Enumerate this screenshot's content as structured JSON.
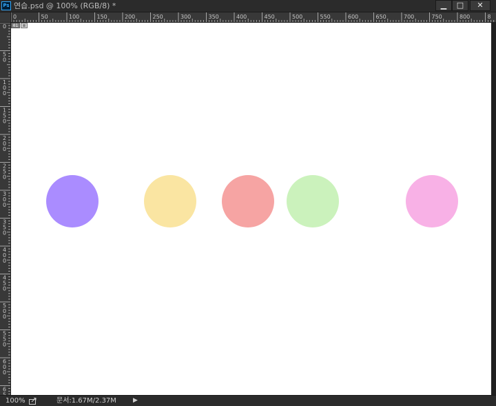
{
  "window": {
    "app_icon": "Ps",
    "title": "연습.psd @ 100% (RGB/8) *",
    "controls": {
      "minimize": "▁",
      "maximize": "□",
      "close": "✕"
    }
  },
  "ruler_h": {
    "labels": [
      "0",
      "50",
      "100",
      "150",
      "200",
      "250",
      "300",
      "350",
      "400",
      "450",
      "500",
      "550",
      "600",
      "650",
      "700",
      "750",
      "800",
      "8"
    ]
  },
  "ruler_v": {
    "labels": [
      "0",
      "5 0",
      "1 0 0",
      "1 5 0",
      "2 0 0",
      "2 5 0",
      "3 0 0",
      "3 5 0",
      "4 0 0",
      "4 5 0",
      "5 0 0",
      "5 5 0",
      "6 0 0",
      "6 5"
    ]
  },
  "canvas": {
    "slice_number": "01",
    "slice_icon": "⊠",
    "circles": [
      {
        "name": "purple-circle",
        "color": "#aa8cff"
      },
      {
        "name": "yellow-circle",
        "color": "#fae5a2"
      },
      {
        "name": "red-circle",
        "color": "#f6a4a3"
      },
      {
        "name": "green-circle",
        "color": "#cbf2bc"
      },
      {
        "name": "pink-circle",
        "color": "#f8b1e6"
      }
    ]
  },
  "status": {
    "zoom": "100%",
    "document_info": "문서:1.67M/2.37M",
    "arrow": "▶"
  }
}
